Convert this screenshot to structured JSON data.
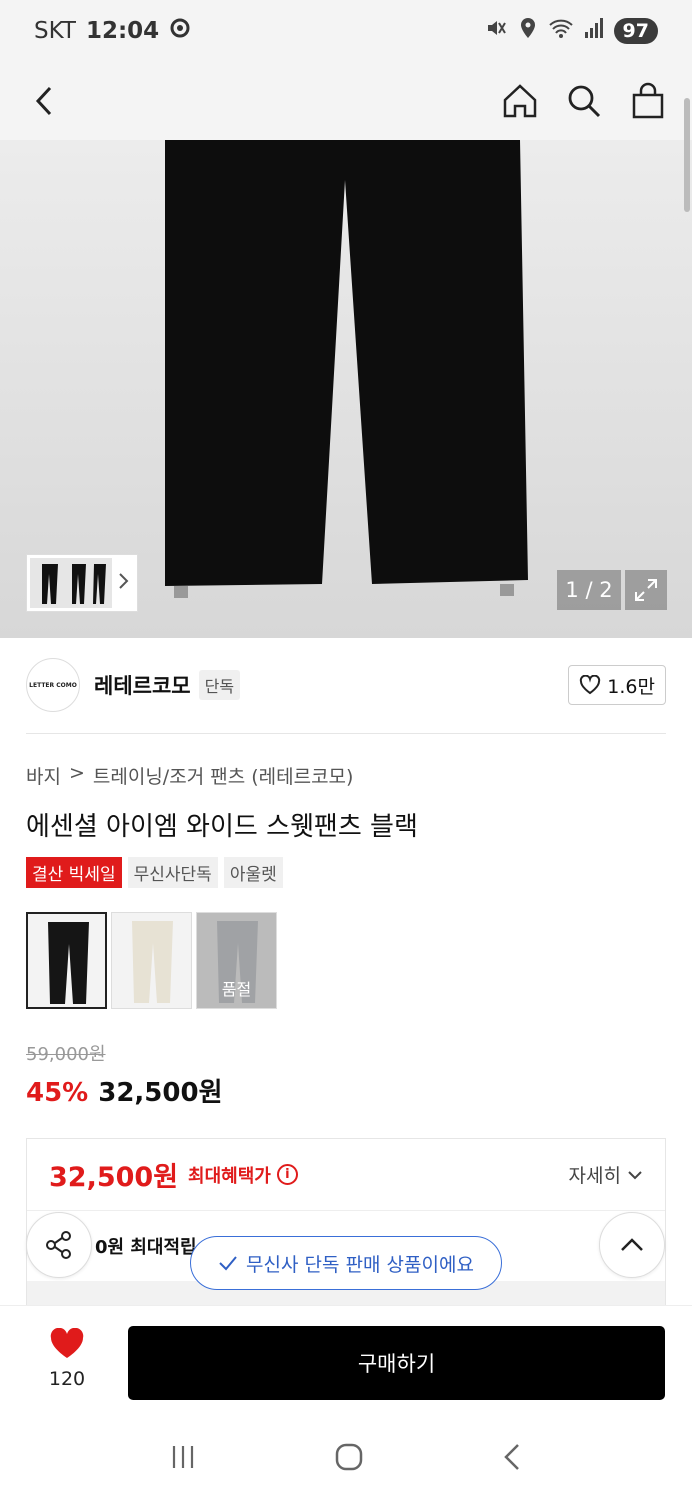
{
  "status_bar": {
    "carrier": "SKT",
    "time": "12:04",
    "battery": "97"
  },
  "product_image": {
    "counter": "1 / 2"
  },
  "brand": {
    "logo_text": "LETTER COMO",
    "name": "레테르코모",
    "badge": "단독",
    "likes": "1.6만"
  },
  "breadcrumb": {
    "category": "바지",
    "separator": ">",
    "subcategory": "트레이닝/조거 팬츠 (레테르코모)"
  },
  "product": {
    "title": "에센셜 아이엠 와이드 스웻팬츠 블랙",
    "tags": [
      "결산 빅세일",
      "무신사단독",
      "아울렛"
    ],
    "swatches": [
      {
        "color": "#1a1a1a",
        "sold_out": ""
      },
      {
        "color": "#e7e2d4",
        "sold_out": ""
      },
      {
        "color": "#b9bcc4",
        "sold_out": "품절"
      }
    ],
    "original_price": "59,000원",
    "discount": "45%",
    "sale_price": "32,500원"
  },
  "benefit": {
    "price": "32,500원",
    "label": "최대혜택가",
    "info_symbol": "i",
    "detail": "자세히",
    "points": "0원 최대적립"
  },
  "toast": {
    "text": "무신사 단독 판매 상품이에요"
  },
  "bottom_bar": {
    "like_count": "120",
    "buy_label": "구매하기"
  },
  "colors": {
    "accent_red": "#e01b1b",
    "toast_blue": "#2f5fc4",
    "buy_bg": "#000000"
  }
}
